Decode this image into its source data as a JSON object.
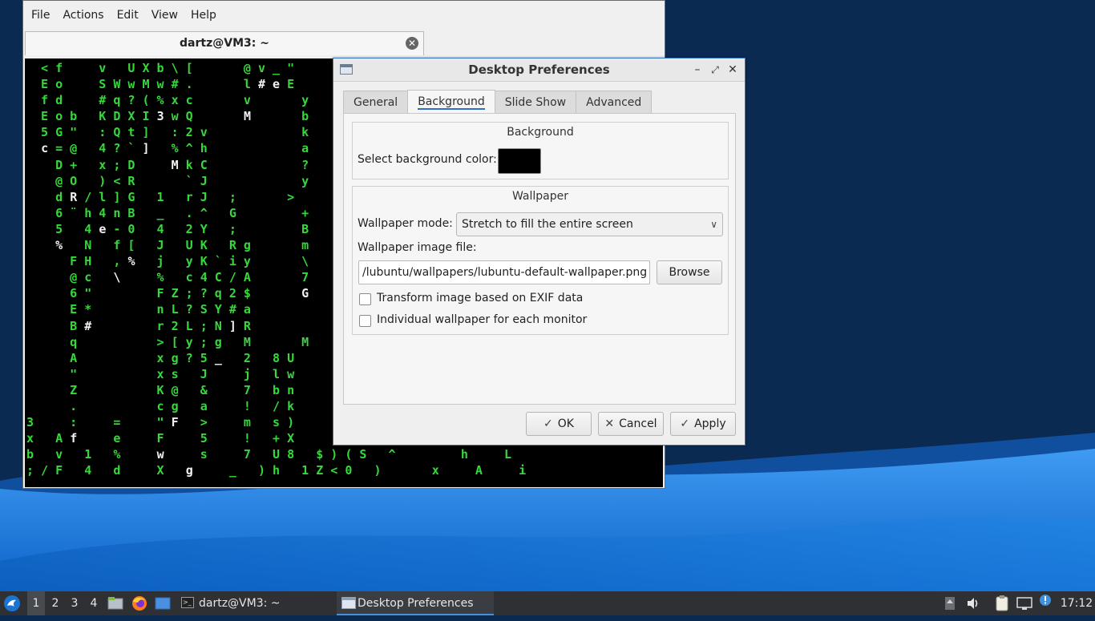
{
  "terminal": {
    "menu": [
      "File",
      "Actions",
      "Edit",
      "View",
      "Help"
    ],
    "tab_title": "dartz@VM3: ~",
    "tab_close_icon": "close-circle-icon"
  },
  "dialog": {
    "title": "Desktop Preferences",
    "tabs": [
      "General",
      "Background",
      "Slide Show",
      "Advanced"
    ],
    "active_tab": "Background",
    "background_group": {
      "title": "Background",
      "color_label": "Select background color:",
      "color_value": "#000000"
    },
    "wallpaper_group": {
      "title": "Wallpaper",
      "mode_label": "Wallpaper mode:",
      "mode_value": "Stretch to fill the entire screen",
      "file_label": "Wallpaper image file:",
      "file_value": "/lubuntu/wallpapers/lubuntu-default-wallpaper.png",
      "browse_label": "Browse",
      "exif_label": "Transform image based on EXIF data",
      "exif_checked": false,
      "per_monitor_label": "Individual wallpaper for each monitor",
      "per_monitor_checked": false
    },
    "buttons": {
      "ok": "OK",
      "cancel": "Cancel",
      "apply": "Apply"
    }
  },
  "taskbar": {
    "workspaces": [
      "1",
      "2",
      "3",
      "4"
    ],
    "current_workspace": "1",
    "tasks": [
      {
        "label": "dartz@VM3: ~",
        "icon": "terminal-icon"
      },
      {
        "label": "Desktop Preferences",
        "icon": "window-icon",
        "active": true
      }
    ],
    "clock": "17:12"
  },
  "colors": {
    "desktop_dark": "#0b2a52",
    "wave_blue": "#1c78d8",
    "matrix_green": "#36d93a",
    "taskbar": "#2e3033"
  }
}
